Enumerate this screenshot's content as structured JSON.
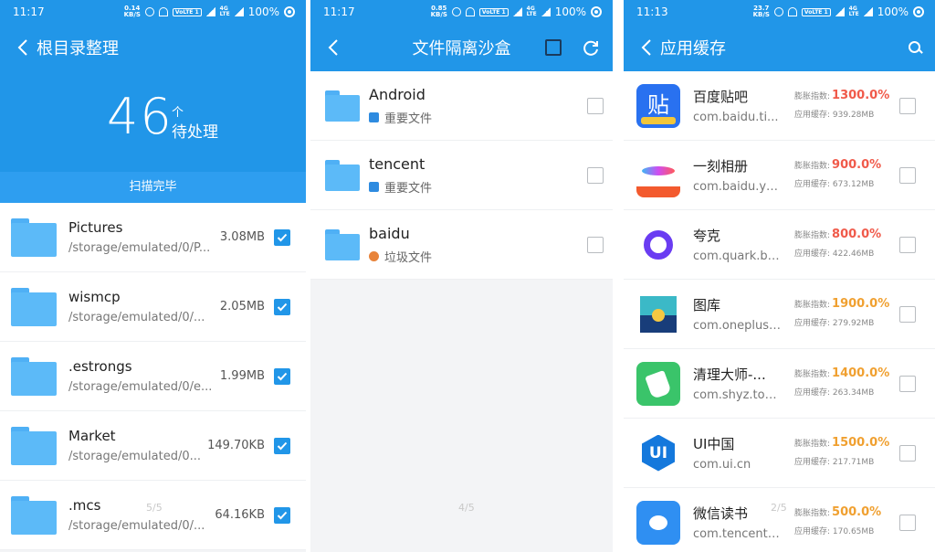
{
  "panel1": {
    "status": {
      "time": "11:17",
      "speed": "0.14\nKB/S",
      "volte": "VoLTE 1",
      "lte": "4G\nLTE",
      "battery": "100%"
    },
    "title": "根目录整理",
    "count": "46",
    "count_unit": "个",
    "count_label": "待处理",
    "scan_status": "扫描完毕",
    "pager": "5/5",
    "items": [
      {
        "name": "Pictures",
        "path": "/storage/emulated/0/P...",
        "size": "3.08MB",
        "checked": true
      },
      {
        "name": "wismcp",
        "path": "/storage/emulated/0/...",
        "size": "2.05MB",
        "checked": true
      },
      {
        "name": ".estrongs",
        "path": "/storage/emulated/0/e...",
        "size": "1.99MB",
        "checked": true
      },
      {
        "name": "Market",
        "path": "/storage/emulated/0...",
        "size": "149.70KB",
        "checked": true
      },
      {
        "name": ".mcs",
        "path": "/storage/emulated/0/...",
        "size": "64.16KB",
        "checked": true
      }
    ]
  },
  "panel2": {
    "status": {
      "time": "11:17",
      "speed": "0.85\nKB/S",
      "volte": "VoLTE 1",
      "lte": "4G\nLTE",
      "battery": "100%"
    },
    "title": "文件隔离沙盒",
    "pager": "4/5",
    "items": [
      {
        "name": "Android",
        "tag": "重要文件",
        "tag_type": "important"
      },
      {
        "name": "tencent",
        "tag": "重要文件",
        "tag_type": "important"
      },
      {
        "name": "baidu",
        "tag": "垃圾文件",
        "tag_type": "junk"
      }
    ]
  },
  "panel3": {
    "status": {
      "time": "11:13",
      "speed": "23.7\nKB/S",
      "volte": "VoLTE 1",
      "lte": "4G\nLTE",
      "battery": "100%"
    },
    "title": "应用缓存",
    "pager": "2/5",
    "metric_label": "膨胀指数:",
    "cache_label": "应用缓存:",
    "items": [
      {
        "name": "百度贴吧",
        "pkg": "com.baidu.ti...",
        "pct": "1300.0%",
        "cache": "939.28MB",
        "color": "#f05a4a",
        "icon": "baidu-tieba-icon"
      },
      {
        "name": "一刻相册",
        "pkg": "com.baidu.you...",
        "pct": "900.0%",
        "cache": "673.12MB",
        "color": "#f05a4a",
        "icon": "yike-album-icon"
      },
      {
        "name": "夸克",
        "pkg": "com.quark.bro...",
        "pct": "800.0%",
        "cache": "422.46MB",
        "color": "#f05a4a",
        "icon": "quark-icon"
      },
      {
        "name": "图库",
        "pkg": "com.oneplus....",
        "pct": "1900.0%",
        "cache": "279.92MB",
        "color": "#f0a030",
        "icon": "gallery-icon"
      },
      {
        "name": "清理大师-...",
        "pkg": "com.shyz.tou...",
        "pct": "1400.0%",
        "cache": "263.34MB",
        "color": "#f0a030",
        "icon": "cleaner-icon"
      },
      {
        "name": "UI中国",
        "pkg": "com.ui.cn",
        "pct": "1500.0%",
        "cache": "217.71MB",
        "color": "#f0a030",
        "icon": "ui-china-icon"
      },
      {
        "name": "微信读书",
        "pkg": "com.tencent.w...",
        "pct": "500.0%",
        "cache": "170.65MB",
        "color": "#f0a030",
        "icon": "weread-icon"
      }
    ]
  }
}
